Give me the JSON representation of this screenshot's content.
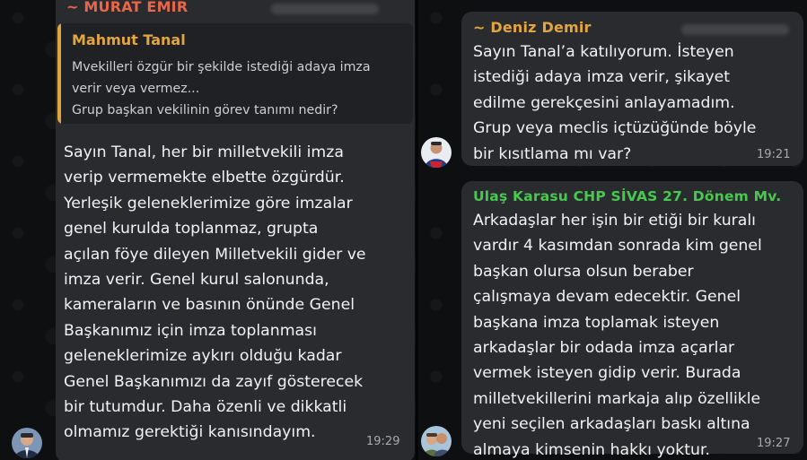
{
  "left_chat": {
    "message": {
      "sender": "~ MURAT EMIR",
      "sender_color": "#e8674a",
      "quote": {
        "author": "Mahmut Tanal",
        "lines": [
          "Mvekilleri özgür bir şekilde istediği adaya imza",
          "verir veya vermez...",
          "Grup başkan vekilinin görev tanımı nedir?"
        ]
      },
      "lines": [
        "Sayın Tanal, her bir milletvekili imza",
        "verip vermemekte elbette özgürdür.",
        "Yerleşik geleneklerimize göre imzalar",
        "genel kurulda toplanmaz, grupta",
        "açılan föye dileyen Milletvekili gider ve",
        "imza verir. Genel kurul salonunda,",
        "kameraların ve basının önünde Genel",
        "Başkanımız için imza toplanması",
        "geleneklerimize aykırı olduğu kadar",
        "Genel Başkanımızı da zayıf gösterecek",
        "bir tutumdur. Daha özenli ve dikkatli",
        "olmamız gerektiği kanısındayım."
      ],
      "time": "19:29"
    }
  },
  "right_chat": {
    "messages": [
      {
        "sender": "~ Deniz Demir",
        "sender_color": "#e3a63f",
        "lines": [
          "Sayın Tanal’a katılıyorum. İsteyen",
          "istediği adaya imza verir, şikayet",
          "edilme gerekçesini anlayamadım.",
          "Grup veya meclis içtüzüğünde böyle",
          "bir kısıtlama mı var?"
        ],
        "time": "19:21"
      },
      {
        "sender": "Ulaş Karasu CHP SİVAS 27. Dönem Mv.",
        "sender_color": "#47c94f",
        "lines": [
          "Arkadaşlar her işin bir etiği bir kuralı",
          "vardır 4 kasımdan sonrada kim genel",
          "başkan olursa olsun beraber",
          "çalışmaya devam edecektir. Genel",
          "başkana imza toplamak isteyen",
          "arkadaşlar bir odada imza açarlar",
          "vermek isteyen gidip verir. Burada",
          "milletvekillerini markaja alıp özellikle",
          "yeni seçilen arkadaşları baskı altına",
          "almaya kimsenin hakkı yoktur."
        ],
        "time": "19:27"
      }
    ]
  }
}
